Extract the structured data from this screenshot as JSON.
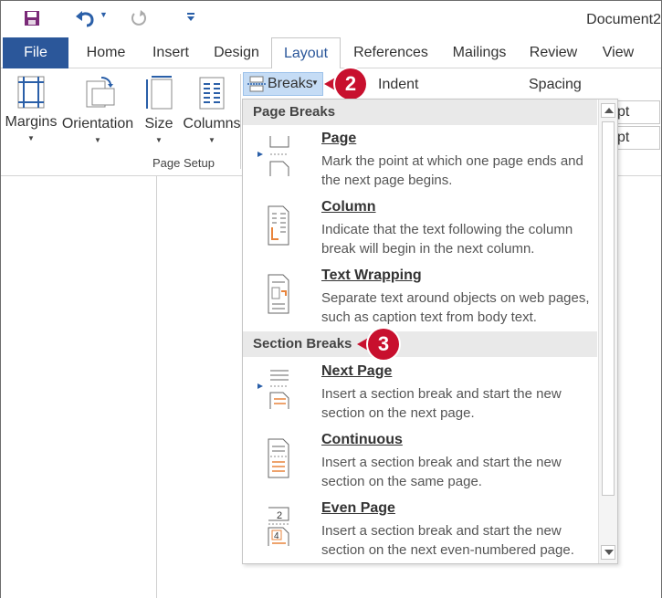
{
  "window": {
    "title": "Document2"
  },
  "quick_access": {
    "save_icon": "save-icon",
    "undo_icon": "undo-icon",
    "redo_icon": "redo-icon",
    "customize_icon": "customize-icon"
  },
  "tabs": [
    {
      "label": "File"
    },
    {
      "label": "Home"
    },
    {
      "label": "Insert"
    },
    {
      "label": "Design"
    },
    {
      "label": "Layout"
    },
    {
      "label": "References"
    },
    {
      "label": "Mailings"
    },
    {
      "label": "Review"
    },
    {
      "label": "View"
    }
  ],
  "ribbon": {
    "margins": "Margins",
    "orientation": "Orientation",
    "size": "Size",
    "columns": "Columns",
    "breaks": "Breaks",
    "group_label": "Page Setup",
    "indent": "Indent",
    "spacing": "Spacing",
    "spin1": "pt",
    "spin2": "pt"
  },
  "callouts": {
    "first": "2",
    "second": "3"
  },
  "menu": {
    "page_breaks_header": "Page Breaks",
    "section_breaks_header": "Section Breaks",
    "items": [
      {
        "title": "Page",
        "desc": "Mark the point at which one page ends and the next page begins."
      },
      {
        "title": "Column",
        "desc": "Indicate that the text following the column break will begin in the next column."
      },
      {
        "title": "Text Wrapping",
        "desc": "Separate text around objects on web pages, such as caption text from body text."
      },
      {
        "title": "Next Page",
        "desc": "Insert a section break and start the new section on the next page."
      },
      {
        "title": "Continuous",
        "desc": "Insert a section break and start the new section on the same page."
      },
      {
        "title": "Even Page",
        "desc": "Insert a section break and start the new section on the next even-numbered page."
      }
    ]
  },
  "colors": {
    "accent": "#2b579a",
    "callout": "#c8102e",
    "highlight": "#c5dcf5",
    "icon_orange": "#e8843c"
  }
}
